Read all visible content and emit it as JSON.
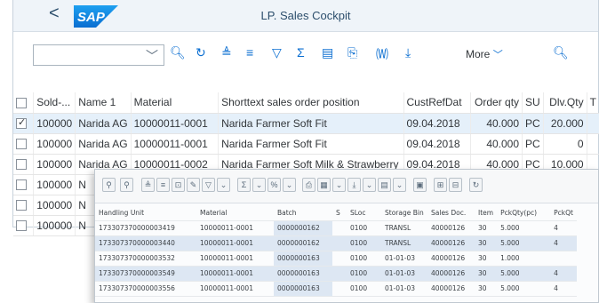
{
  "app": {
    "title": "LP. Sales Cockpit",
    "back_glyph": "<",
    "brand": "SAP"
  },
  "toolbar": {
    "combo_value": "",
    "more_label": "More",
    "icons": [
      "search-icon",
      "refresh-icon",
      "sort-ascending-icon",
      "sort-descending-icon",
      "filter-icon",
      "sum-icon",
      "details-icon",
      "export-icon",
      "word-processing-icon",
      "download-icon"
    ]
  },
  "grid": {
    "headers": [
      "Sold-...",
      "Name 1",
      "Material",
      "Shorttext sales order position",
      "CustRefDat",
      "Order qty",
      "SU",
      "Dlv.Qty",
      "T"
    ],
    "rows": [
      {
        "selected": true,
        "sold": "100000",
        "name": "Narida AG",
        "material": "10000011-0001",
        "text": "Narida Farmer Soft Fit",
        "date": "09.04.2018",
        "qty": "40.000",
        "su": "PC",
        "dlv": "20.000"
      },
      {
        "selected": false,
        "sold": "100000",
        "name": "Narida AG",
        "material": "10000011-0001",
        "text": "Narida Farmer Soft Fit",
        "date": "09.04.2018",
        "qty": "40.000",
        "su": "PC",
        "dlv": "0"
      },
      {
        "selected": false,
        "sold": "100000",
        "name": "Narida AG",
        "material": "10000011-0002",
        "text": "Narida Farmer Soft Milk & Strawberry",
        "date": "09.04.2018",
        "qty": "40.000",
        "su": "PC",
        "dlv": "10.000"
      },
      {
        "selected": false,
        "sold": "100000",
        "name": "N"
      },
      {
        "selected": false,
        "sold": "100000",
        "name": "N"
      },
      {
        "selected": false,
        "sold": "100000",
        "name": "N"
      }
    ]
  },
  "overlay": {
    "headers": [
      "Handling Unit",
      "Material",
      "Batch",
      "S",
      "SLoc",
      "Storage Bin",
      "Sales Doc.",
      "Item",
      "PckQty(pc)",
      "PckQt"
    ],
    "rows": [
      {
        "hu": "173307370000003419",
        "mat": "10000011-0001",
        "batch": "0000000162",
        "s": "",
        "sloc": "0100",
        "bin": "TRANSL",
        "doc": "40000126",
        "item": "30",
        "pck": "5.000",
        "pck2": "4"
      },
      {
        "hu": "173307370000003440",
        "mat": "10000011-0001",
        "batch": "0000000162",
        "s": "",
        "sloc": "0100",
        "bin": "TRANSL",
        "doc": "40000126",
        "item": "30",
        "pck": "5.000",
        "pck2": "4"
      },
      {
        "hu": "173307370000003532",
        "mat": "10000011-0001",
        "batch": "0000000163",
        "s": "",
        "sloc": "0100",
        "bin": "01-01-03",
        "doc": "40000126",
        "item": "30",
        "pck": "1.000",
        "pck2": ""
      },
      {
        "hu": "173307370000003549",
        "mat": "10000011-0001",
        "batch": "0000000163",
        "s": "",
        "sloc": "0100",
        "bin": "01-01-03",
        "doc": "40000126",
        "item": "30",
        "pck": "5.000",
        "pck2": "4"
      },
      {
        "hu": "173307370000003556",
        "mat": "10000011-0001",
        "batch": "0000000163",
        "s": "",
        "sloc": "0100",
        "bin": "01-01-03",
        "doc": "40000126",
        "item": "30",
        "pck": "5.000",
        "pck2": "4"
      }
    ]
  }
}
